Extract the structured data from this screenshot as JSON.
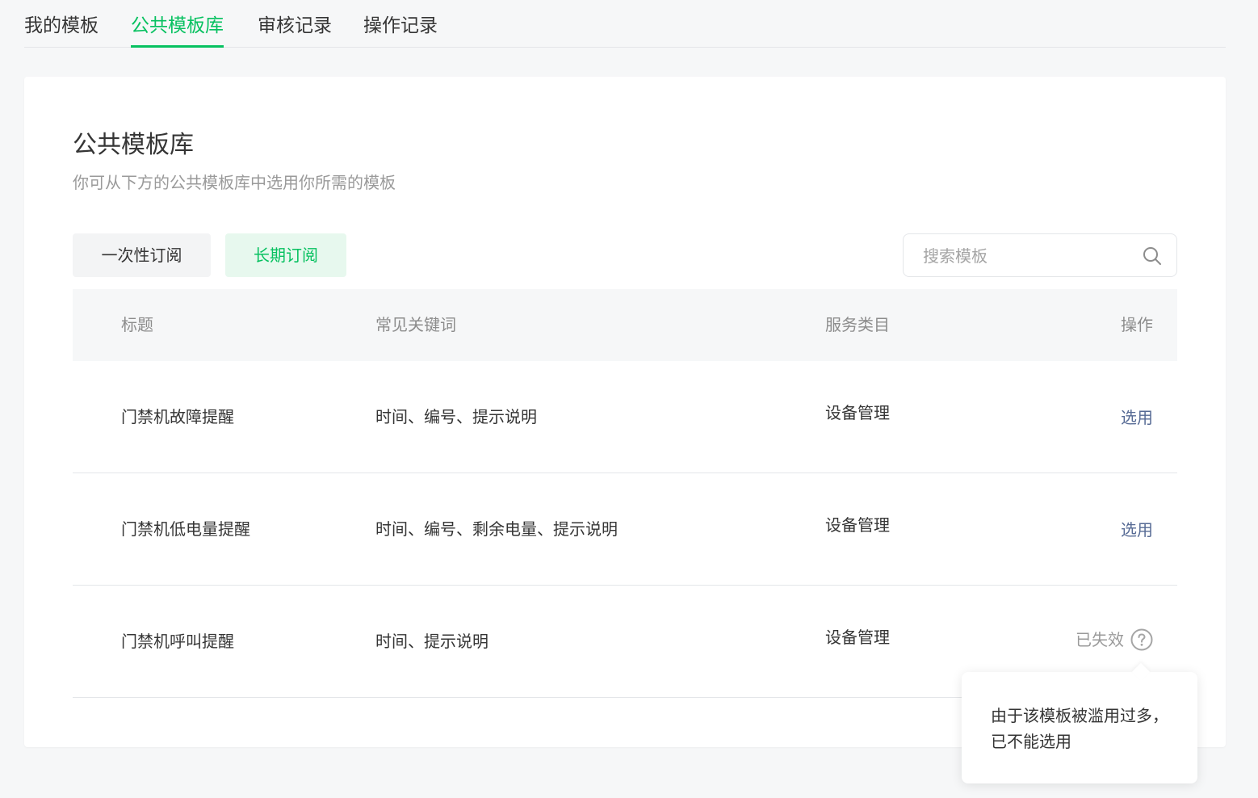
{
  "tabs": [
    {
      "label": "我的模板",
      "active": false
    },
    {
      "label": "公共模板库",
      "active": true
    },
    {
      "label": "审核记录",
      "active": false
    },
    {
      "label": "操作记录",
      "active": false
    }
  ],
  "card": {
    "title": "公共模板库",
    "description": "你可从下方的公共模板库中选用你所需的模板"
  },
  "filters": {
    "one_time": "一次性订阅",
    "long_term": "长期订阅",
    "selected": "长期订阅"
  },
  "search": {
    "placeholder": "搜索模板",
    "value": ""
  },
  "table": {
    "headers": {
      "title": "标题",
      "keywords": "常见关键词",
      "category": "服务类目",
      "action": "操作"
    },
    "rows": [
      {
        "title": "门禁机故障提醒",
        "keywords": "时间、编号、提示说明",
        "category": "设备管理",
        "action": "选用",
        "status": "available"
      },
      {
        "title": "门禁机低电量提醒",
        "keywords": "时间、编号、剩余电量、提示说明",
        "category": "设备管理",
        "action": "选用",
        "status": "available"
      },
      {
        "title": "门禁机呼叫提醒",
        "keywords": "时间、提示说明",
        "category": "设备管理",
        "action": "已失效",
        "status": "expired"
      }
    ]
  },
  "tooltip": {
    "text": "由于该模板被滥用过多，已不能选用"
  },
  "colors": {
    "accent": "#07c160",
    "link": "#576b95",
    "muted": "#9a9a9a",
    "background": "#f6f7f8"
  },
  "icons": {
    "search": "search-icon",
    "help": "question-circle-icon"
  }
}
